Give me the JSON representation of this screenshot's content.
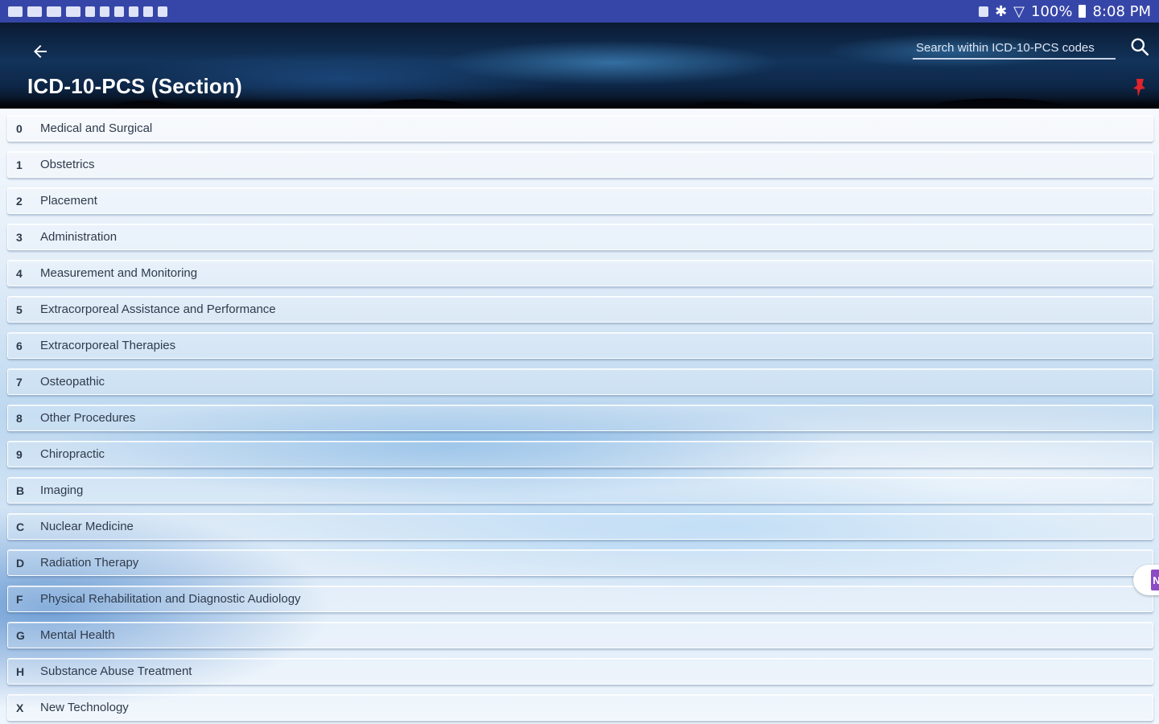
{
  "status_bar": {
    "battery": "100%",
    "time": "8:08 PM"
  },
  "app_bar": {
    "title": "ICD-10-PCS (Section)",
    "search_placeholder": "Search within ICD-10-PCS codes"
  },
  "sections": [
    {
      "code": "0",
      "label": "Medical and Surgical"
    },
    {
      "code": "1",
      "label": "Obstetrics"
    },
    {
      "code": "2",
      "label": "Placement"
    },
    {
      "code": "3",
      "label": "Administration"
    },
    {
      "code": "4",
      "label": "Measurement and Monitoring"
    },
    {
      "code": "5",
      "label": "Extracorporeal Assistance and Performance"
    },
    {
      "code": "6",
      "label": "Extracorporeal Therapies"
    },
    {
      "code": "7",
      "label": "Osteopathic"
    },
    {
      "code": "8",
      "label": "Other Procedures"
    },
    {
      "code": "9",
      "label": "Chiropractic"
    },
    {
      "code": "B",
      "label": "Imaging"
    },
    {
      "code": "C",
      "label": "Nuclear Medicine"
    },
    {
      "code": "D",
      "label": "Radiation Therapy"
    },
    {
      "code": "F",
      "label": "Physical Rehabilitation and Diagnostic Audiology"
    },
    {
      "code": "G",
      "label": "Mental Health"
    },
    {
      "code": "H",
      "label": "Substance Abuse Treatment"
    },
    {
      "code": "X",
      "label": "New Technology"
    }
  ],
  "side_tab": {
    "label": "N",
    "color": "#8c4cc4"
  },
  "colors": {
    "status_bar": "#3646a8",
    "pin": "#e0242c"
  }
}
